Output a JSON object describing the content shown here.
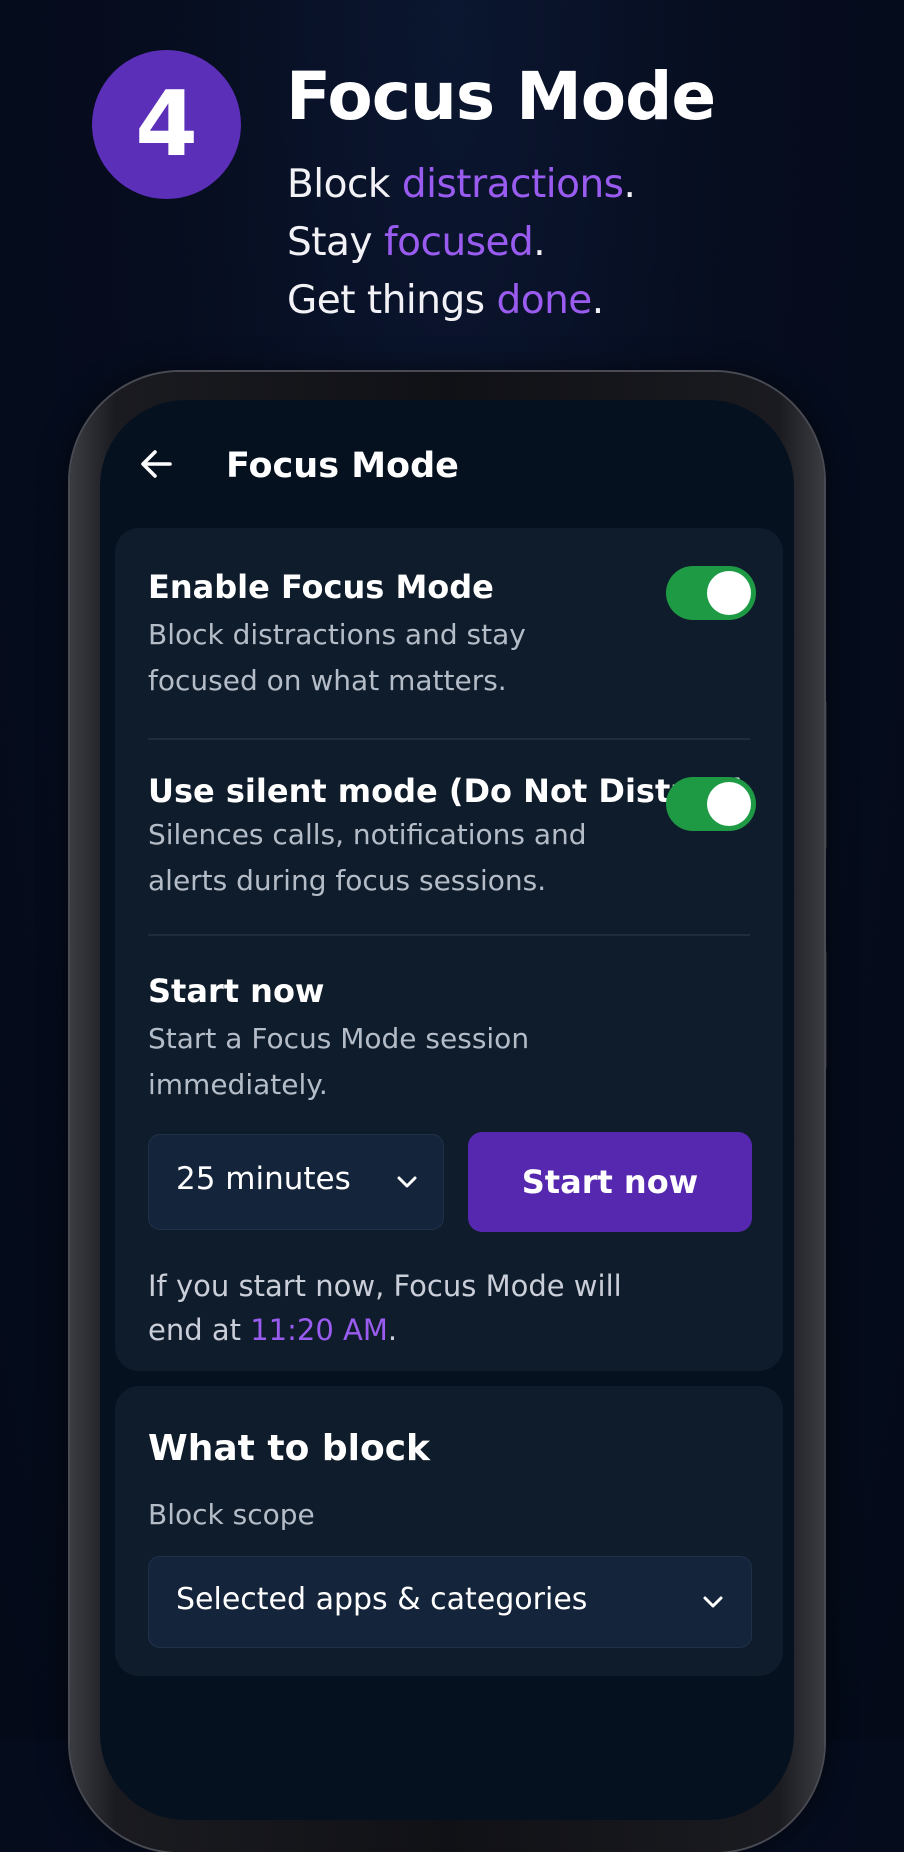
{
  "header": {
    "step_number": "4",
    "title": "Focus Mode",
    "tagline": [
      {
        "prefix": "Block ",
        "highlight": "distractions",
        "suffix": "."
      },
      {
        "prefix": "Stay ",
        "highlight": "focused",
        "suffix": "."
      },
      {
        "prefix": "Get things ",
        "highlight": "done",
        "suffix": "."
      }
    ]
  },
  "colors": {
    "accent": "#9a5cf0",
    "button": "#5628b0",
    "toggle_on": "#1e9a45",
    "badge": "#5b2fb8",
    "background": "#060d1f"
  },
  "app": {
    "back_icon": "arrow-left-icon",
    "title": "Focus Mode",
    "settings": {
      "enable": {
        "title": "Enable Focus Mode",
        "description": "Block distractions and stay focused on what matters.",
        "enabled": true
      },
      "silent": {
        "title": "Use silent mode (Do Not Disturb)",
        "description": "Silences calls, notifications and alerts during focus sessions.",
        "enabled": true
      },
      "start": {
        "title": "Start now",
        "description": "Start a Focus Mode session immediately.",
        "duration": "25 minutes",
        "button_label": "Start now",
        "end_note_prefix": "If you start now, Focus Mode will end at ",
        "end_time": "11:20 AM",
        "end_note_suffix": "."
      }
    },
    "block": {
      "title": "What to block",
      "scope_label": "Block scope",
      "scope_value": "Selected apps & categories"
    }
  }
}
